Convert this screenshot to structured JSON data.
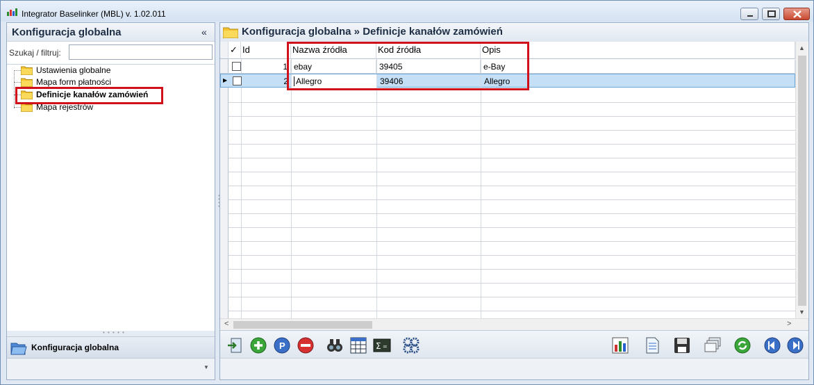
{
  "window": {
    "title": "Integrator Baselinker (MBL) v. 1.02.011"
  },
  "left_panel": {
    "title": "Konfiguracja globalna",
    "collapse_glyph": "«",
    "search_label": "Szukaj / filtruj:",
    "search_value": "",
    "tree": [
      {
        "label": "Ustawienia globalne",
        "selected": false
      },
      {
        "label": "Mapa form płatności",
        "selected": false
      },
      {
        "label": "Definicje kanałów zamówień",
        "selected": true
      },
      {
        "label": "Mapa rejestrów",
        "selected": false
      }
    ],
    "footer_label": "Konfiguracja globalna"
  },
  "main": {
    "breadcrumb": "Konfiguracja globalna » Definicje kanałów zamówień",
    "columns": {
      "check": "✓",
      "id": "Id",
      "name": "Nazwa źródła",
      "code": "Kod źródła",
      "desc": "Opis"
    },
    "rows": [
      {
        "id": "1",
        "name": "ebay",
        "code": "39405",
        "desc": "e-Bay",
        "selected": false
      },
      {
        "id": "2",
        "name": "Allegro",
        "code": "39406",
        "desc": "Allegro",
        "selected": true
      }
    ]
  },
  "toolbar": {
    "left_icons": [
      "exit-icon",
      "add-icon",
      "edit-icon",
      "delete-icon",
      "find-icon",
      "calendar-grid-icon",
      "sum-icon",
      "settings-icon"
    ],
    "right_icons": [
      "report-icon",
      "document-icon",
      "save-icon",
      "windows-icon",
      "refresh-icon",
      "previous-icon",
      "next-icon"
    ]
  },
  "colors": {
    "highlight_red": "#d0111b",
    "selected_row": "#c4dff6",
    "frame": "#dfe8f3"
  }
}
